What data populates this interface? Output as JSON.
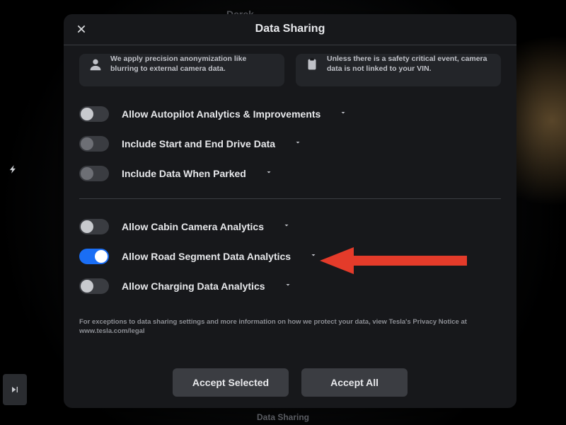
{
  "background": {
    "profile_name": "Derek",
    "footer_label": "Data Sharing"
  },
  "panel": {
    "title": "Data Sharing",
    "cards": {
      "anonymization": "We apply precision anonymization like blurring to external camera data.",
      "vin": "Unless there is a safety critical event, camera data is not linked to your VIN."
    },
    "toggles": {
      "autopilot": {
        "label": "Allow Autopilot Analytics & Improvements",
        "on": false
      },
      "drive_data": {
        "label": "Include Start and End Drive Data",
        "on": false
      },
      "parked": {
        "label": "Include Data When Parked",
        "on": false
      },
      "cabin": {
        "label": "Allow Cabin Camera Analytics",
        "on": false
      },
      "road_segment": {
        "label": "Allow Road Segment Data Analytics",
        "on": true
      },
      "charging": {
        "label": "Allow Charging Data Analytics",
        "on": false
      }
    },
    "footnote": "For exceptions to data sharing settings and more information on how we protect your data, view Tesla's Privacy Notice at www.tesla.com/legal",
    "buttons": {
      "accept_selected": "Accept Selected",
      "accept_all": "Accept All"
    }
  },
  "colors": {
    "accent": "#1a6ef5",
    "annotation": "#e43b2a"
  }
}
